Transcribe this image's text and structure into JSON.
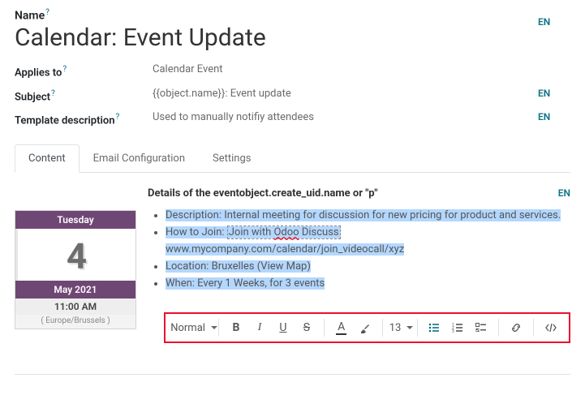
{
  "labels": {
    "name": "Name",
    "applies_to": "Applies to",
    "subject": "Subject",
    "template_description": "Template description"
  },
  "values": {
    "name": "Calendar: Event Update",
    "applies_to": "Calendar Event",
    "subject": "{{object.name}}: Event update",
    "template_description": "Used to manually notifiy attendees"
  },
  "lang": {
    "en": "EN"
  },
  "tabs": {
    "content": "Content",
    "email_config": "Email Configuration",
    "settings": "Settings"
  },
  "calendar": {
    "weekday": "Tuesday",
    "day": "4",
    "month_year": "May 2021",
    "time": "11:00 AM",
    "timezone": "( Europe/Brussels )"
  },
  "details": {
    "heading": "Details of the eventobject.create_uid.name or \"p\"",
    "desc_prefix": "Description: ",
    "desc_body": "Internal meeting for discussion for new pricing for product and services.",
    "how_prefix": "How to Join: ",
    "how_join_a": "Join with ",
    "how_join_odoo": "Odoo",
    "how_join_b": " Discuss",
    "how_url": "www.mycompany.com/calendar/join_videocall/xyz",
    "location_prefix": "Location: ",
    "location_body": "Bruxelles (View Map)",
    "when_prefix": "When: ",
    "when_body": "Every 1 Weeks, for 3 events"
  },
  "toolbar": {
    "style": "Normal",
    "size": "13"
  }
}
